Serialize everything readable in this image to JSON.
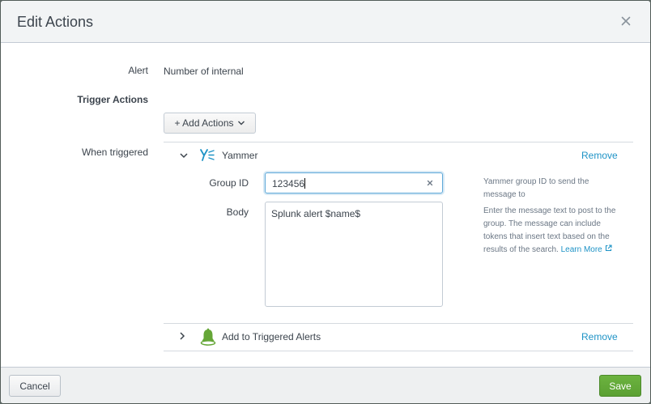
{
  "dialog": {
    "title": "Edit Actions",
    "close_icon": "close-icon"
  },
  "form": {
    "alert_label": "Alert",
    "alert_value": "Number of internal",
    "trigger_actions_label": "Trigger Actions",
    "add_actions_label": "+ Add Actions",
    "when_triggered_label": "When triggered"
  },
  "actions": [
    {
      "name": "Yammer",
      "icon": "yammer-icon",
      "expanded": true,
      "remove_label": "Remove",
      "fields": {
        "group_id_label": "Group ID",
        "group_id_value": "123456",
        "group_id_help": [
          "Yammer group ID to send the",
          "message to"
        ],
        "body_label": "Body",
        "body_value": "Splunk alert $name$",
        "body_help": [
          "Enter the message text to post to the",
          "group. The message can include",
          "tokens that insert text based on the",
          "results of the search."
        ],
        "learn_more": "Learn More"
      }
    },
    {
      "name": "Add to Triggered Alerts",
      "icon": "bell-icon",
      "expanded": false,
      "remove_label": "Remove"
    }
  ],
  "footer": {
    "cancel_label": "Cancel",
    "save_label": "Save"
  },
  "colors": {
    "link": "#1e93c6",
    "primary": "#5ba033",
    "header_bg": "#f2f4f5",
    "bell": "#65a637"
  }
}
